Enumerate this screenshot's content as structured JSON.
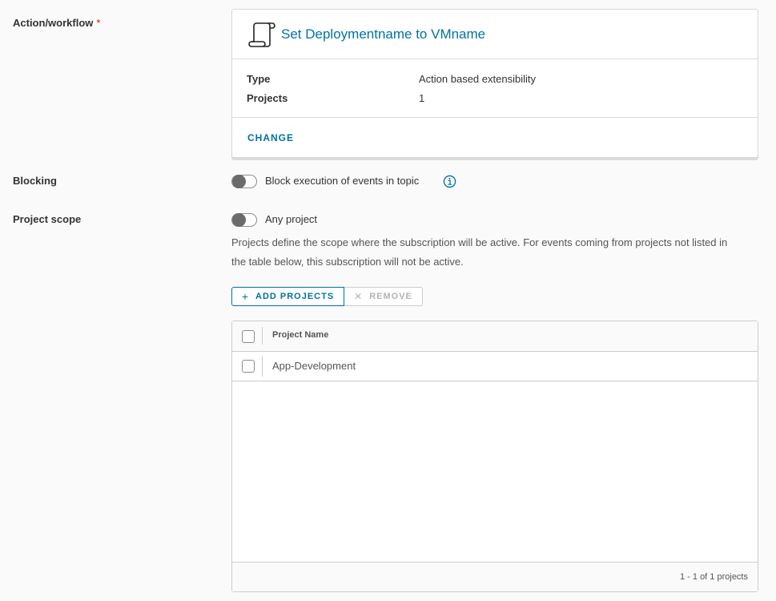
{
  "action_workflow": {
    "label": "Action/workflow",
    "required_mark": "*",
    "card": {
      "icon": "script-scroll-icon",
      "title": "Set Deploymentname to VMname",
      "type_label": "Type",
      "type_value": "Action based extensibility",
      "projects_label": "Projects",
      "projects_value": "1",
      "change_label": "CHANGE"
    }
  },
  "blocking": {
    "label": "Blocking",
    "toggle_label": "Block execution of events in topic",
    "toggle_on": false,
    "info_icon": "info-circle-icon"
  },
  "project_scope": {
    "label": "Project scope",
    "toggle_label": "Any project",
    "toggle_on": false,
    "description": "Projects define the scope where the subscription will be active. For events coming from projects not listed in the table below, this subscription will not be active.",
    "add_button": "ADD PROJECTS",
    "remove_button": "REMOVE",
    "table": {
      "column_header": "Project Name",
      "rows": [
        {
          "name": "App-Development",
          "selected": false
        }
      ],
      "footer": "1 - 1 of 1 projects"
    }
  },
  "colors": {
    "link": "#0072a3",
    "required": "#c92100",
    "background": "#fafafa"
  }
}
